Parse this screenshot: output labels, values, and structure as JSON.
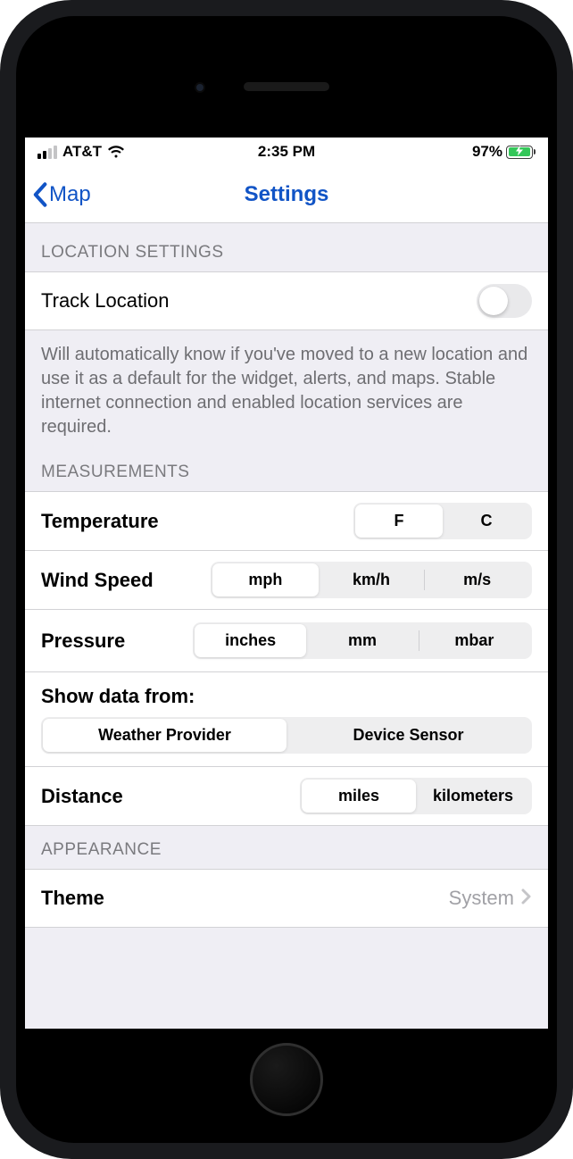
{
  "statusBar": {
    "carrier": "AT&T",
    "time": "2:35 PM",
    "batteryPercent": "97%"
  },
  "nav": {
    "back": "Map",
    "title": "Settings"
  },
  "sections": {
    "location": {
      "header": "LOCATION SETTINGS",
      "trackLabel": "Track Location",
      "footer": "Will automatically know if you've moved to a new location and use it as a default for the widget, alerts, and maps. Stable internet connection and enabled location services are required."
    },
    "measurements": {
      "header": "MEASUREMENTS",
      "temperature": {
        "label": "Temperature",
        "options": [
          "F",
          "C"
        ],
        "selected": 0
      },
      "wind": {
        "label": "Wind Speed",
        "options": [
          "mph",
          "km/h",
          "m/s"
        ],
        "selected": 0
      },
      "pressure": {
        "label": "Pressure",
        "options": [
          "inches",
          "mm",
          "mbar"
        ],
        "selected": 0
      },
      "dataSourceLabel": "Show data from:",
      "dataSource": {
        "options": [
          "Weather Provider",
          "Device Sensor"
        ],
        "selected": 0
      },
      "distance": {
        "label": "Distance",
        "options": [
          "miles",
          "kilometers"
        ],
        "selected": 0
      }
    },
    "appearance": {
      "header": "APPEARANCE",
      "theme": {
        "label": "Theme",
        "value": "System"
      }
    }
  }
}
